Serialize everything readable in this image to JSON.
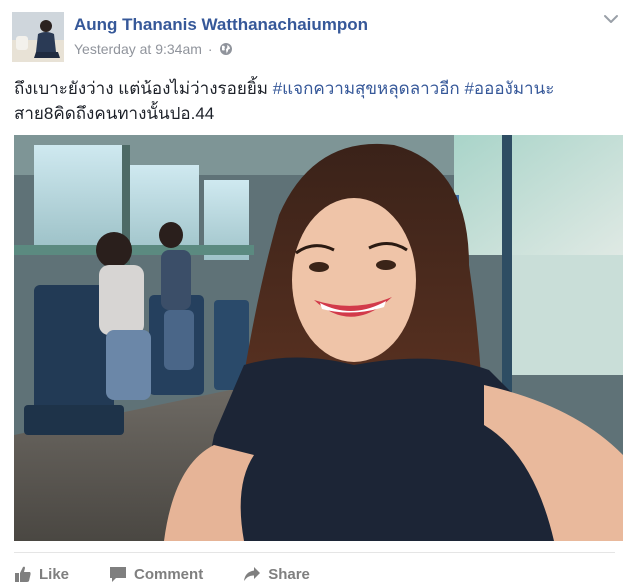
{
  "post": {
    "author": "Aung Thananis Watthanachaiumpon",
    "timestamp": "Yesterday at 9:34am",
    "separator": "·",
    "privacy_icon": "globe-icon",
    "menu_icon": "chevron-down-icon",
    "text_line1_plain": "ถึงเบาะยังว่าง แต่น้องไม่ว่างรอยยิ้ม ",
    "hashtag1": "#แจกความสุขหลุดลาวอีก",
    "hashtag2": "#ออองัมานะ",
    "text_line2": "สาย8คิดถึงคนทางนั้นปอ.44",
    "photo_alt": "photo"
  },
  "actions": {
    "like_label": "Like",
    "comment_label": "Comment",
    "share_label": "Share"
  },
  "colors": {
    "link": "#365899",
    "muted": "#90949c",
    "action": "#7f7f7f"
  }
}
